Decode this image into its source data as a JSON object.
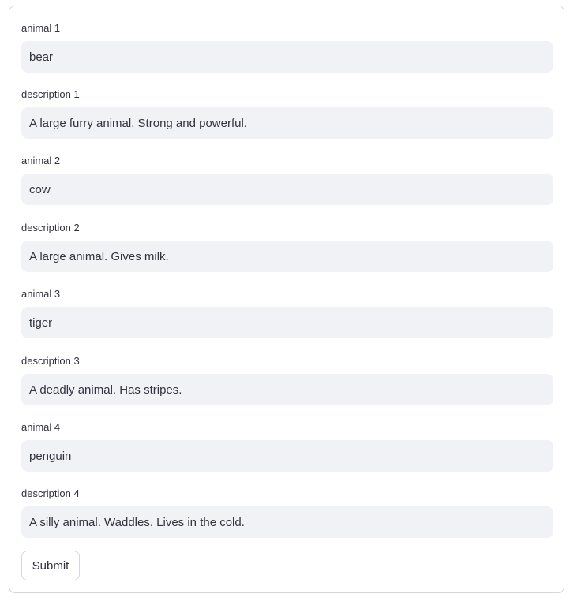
{
  "form": {
    "fields": [
      {
        "label": "animal 1",
        "value": "bear"
      },
      {
        "label": "description 1",
        "value": "A large furry animal. Strong and powerful."
      },
      {
        "label": "animal 2",
        "value": "cow"
      },
      {
        "label": "description 2",
        "value": "A large animal. Gives milk."
      },
      {
        "label": "animal 3",
        "value": "tiger"
      },
      {
        "label": "description 3",
        "value": "A deadly animal. Has stripes."
      },
      {
        "label": "animal 4",
        "value": "penguin"
      },
      {
        "label": "description 4",
        "value": "A silly animal. Waddles. Lives in the cold."
      }
    ],
    "submit_label": "Submit"
  }
}
